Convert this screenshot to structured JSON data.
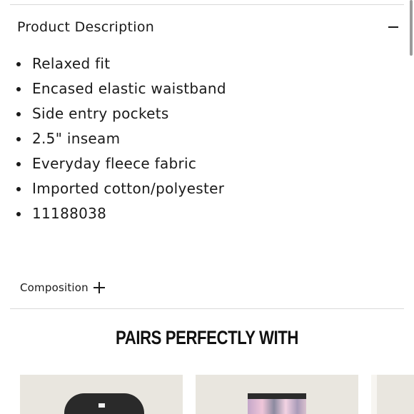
{
  "product_description": {
    "title": "Product Description",
    "toggle_icon": "minus-icon",
    "bullets": [
      "Relaxed fit",
      "Encased elastic waistband",
      "Side entry pockets",
      "2.5\" inseam",
      "Everyday fleece fabric",
      "Imported cotton/polyester",
      "11188038"
    ]
  },
  "composition": {
    "label": "Composition",
    "toggle_icon": "plus-icon"
  },
  "pairs": {
    "heading": "PAIRS PERFECTLY WITH",
    "cards": [
      {
        "image": "black-sweatshirt-image"
      },
      {
        "image": "tie-dye-shorts-image"
      },
      {
        "image": "product-image"
      }
    ]
  },
  "colors": {
    "text": "#1a1a1a",
    "divider": "#d9d9d9",
    "card_background": "#e9e6df"
  }
}
